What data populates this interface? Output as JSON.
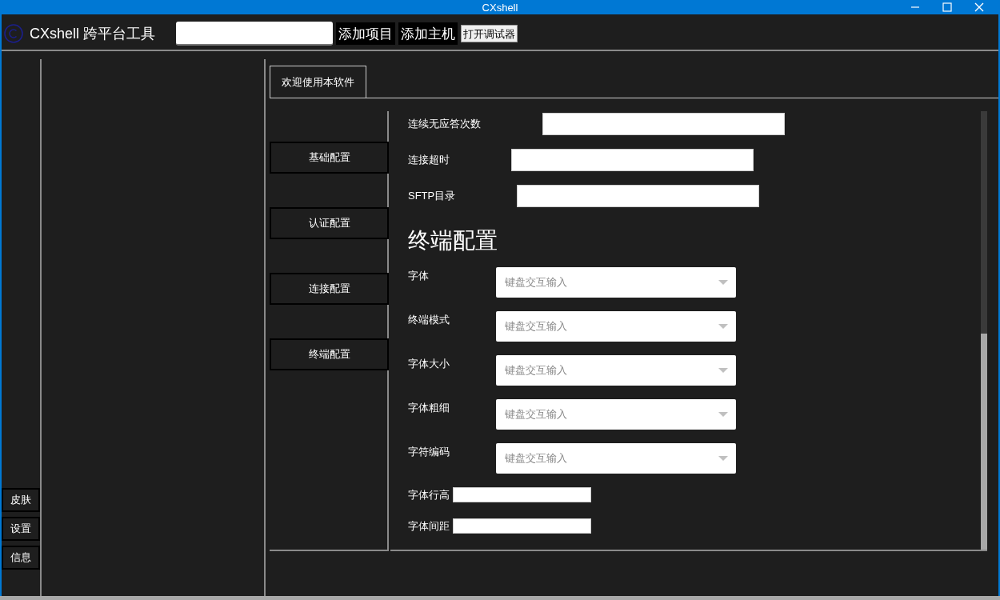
{
  "window": {
    "title": "CXshell"
  },
  "header": {
    "app_name": "CXshell 跨平台工具",
    "buttons": [
      {
        "label": "添加项目",
        "kind": "dark"
      },
      {
        "label": "添加主机",
        "kind": "dark"
      },
      {
        "label": "打开调试器",
        "kind": "light"
      }
    ]
  },
  "side_buttons": [
    "皮肤",
    "设置",
    "信息"
  ],
  "tabs": [
    {
      "label": "欢迎使用本软件",
      "selected": true
    }
  ],
  "config_nav": [
    {
      "label": "基础配置",
      "selected": false
    },
    {
      "label": "认证配置",
      "selected": false
    },
    {
      "label": "连接配置",
      "selected": false
    },
    {
      "label": "终端配置",
      "selected": false
    }
  ],
  "form": [
    {
      "kind": "text",
      "label": "连续无应答次数"
    },
    {
      "kind": "text",
      "label": "连接超时"
    },
    {
      "kind": "text",
      "label": "SFTP目录"
    },
    {
      "kind": "heading",
      "label": "终端配置"
    },
    {
      "kind": "select",
      "label": "字体",
      "placeholder": "键盘交互输入"
    },
    {
      "kind": "select",
      "label": "终端模式",
      "placeholder": "键盘交互输入"
    },
    {
      "kind": "select",
      "label": "字体大小",
      "placeholder": "键盘交互输入"
    },
    {
      "kind": "select",
      "label": "字体粗细",
      "placeholder": "键盘交互输入"
    },
    {
      "kind": "select",
      "label": "字符编码",
      "placeholder": "键盘交互输入"
    },
    {
      "kind": "inline",
      "label": "字体行高"
    },
    {
      "kind": "inline",
      "label": "字体间距"
    }
  ]
}
